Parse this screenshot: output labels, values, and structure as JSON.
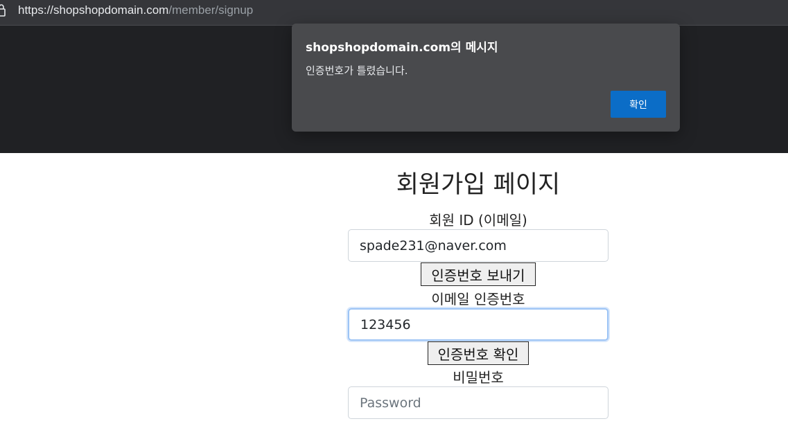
{
  "browser": {
    "url_base": "https://shopshopdomain.com",
    "url_path": "/member/signup"
  },
  "dialog": {
    "title": "shopshopdomain.com의 메시지",
    "message": "인증번호가 틀렸습니다.",
    "ok_label": "확인",
    "ok_color": "#0b6dc7"
  },
  "form": {
    "title": "회원가입 페이지",
    "id_label": "회원 ID (이메일)",
    "id_value": "spade231@naver.com",
    "send_code_label": "인증번호 보내기",
    "code_label": "이메일 인증번호",
    "code_value": "123456",
    "verify_code_label": "인증번호 확인",
    "password_label": "비밀번호",
    "password_placeholder": "Password"
  }
}
